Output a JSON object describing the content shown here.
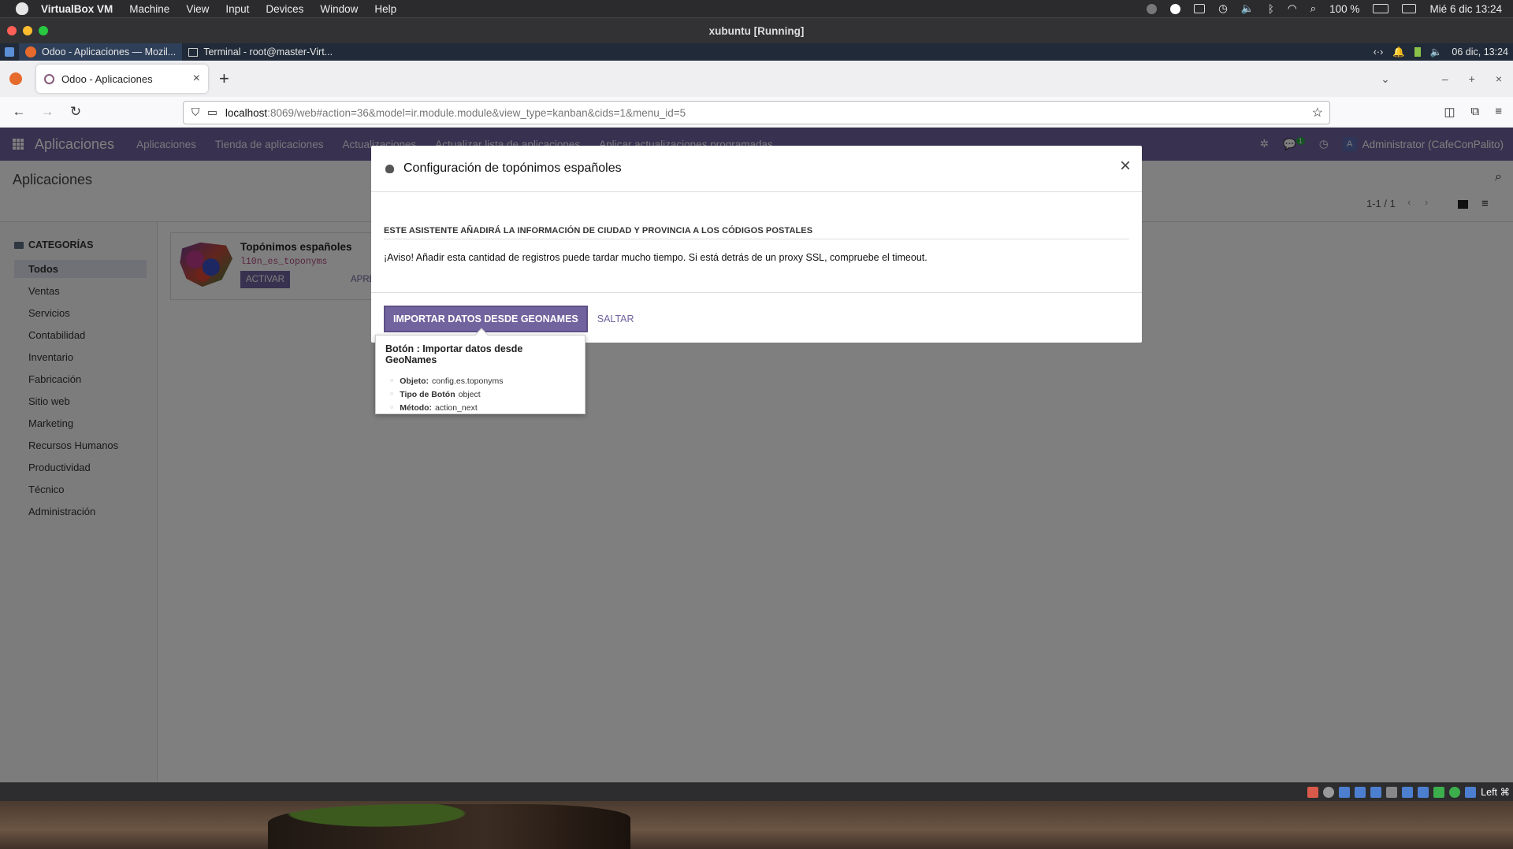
{
  "macos": {
    "app_name": "VirtualBox VM",
    "menus": [
      "Machine",
      "View",
      "Input",
      "Devices",
      "Window",
      "Help"
    ],
    "battery": "100 %",
    "datetime": "Mié 6 dic  13:24"
  },
  "vbox": {
    "window_title": "xubuntu [Running]"
  },
  "xfce": {
    "tasks": [
      {
        "label": "Odoo - Aplicaciones — Mozil..."
      },
      {
        "label": "Terminal - root@master-Virt..."
      }
    ],
    "clock": "06 dic, 13:24"
  },
  "firefox": {
    "tab_title": "Odoo - Aplicaciones",
    "url_host": "localhost",
    "url_rest": ":8069/web#action=36&model=ir.module.module&view_type=kanban&cids=1&menu_id=5"
  },
  "odoo": {
    "brand": "Aplicaciones",
    "menu": [
      "Aplicaciones",
      "Tienda de aplicaciones",
      "Actualizaciones",
      "Actualizar lista de aplicaciones",
      "Aplicar actualizaciones programadas"
    ],
    "chat_badge": "1",
    "avatar_letter": "A",
    "user": "Administrator (CafeConPalito)",
    "breadcrumb": "Aplicaciones",
    "pager": "1-1 / 1",
    "sidebar": {
      "header": "CATEGORÍAS",
      "items": [
        "Todos",
        "Ventas",
        "Servicios",
        "Contabilidad",
        "Inventario",
        "Fabricación",
        "Sitio web",
        "Marketing",
        "Recursos Humanos",
        "Productividad",
        "Técnico",
        "Administración"
      ]
    },
    "card": {
      "title": "Topónimos españoles",
      "technical": "l10n_es_toponyms",
      "activate": "ACTIVAR",
      "learn_more": "APRE"
    }
  },
  "modal": {
    "title": "Configuración de topónimos españoles",
    "separator": "Este asistente añadirá la información de ciudad y provincia a los códigos postales",
    "warning": "¡Aviso! Añadir esta cantidad de registros puede tardar mucho tiempo. Si está detrás de un proxy SSL, compruebe el timeout.",
    "primary_button": "Importar datos desde GeoNames",
    "skip_button": "Saltar"
  },
  "tooltip": {
    "title": "Botón : Importar datos desde GeoNames",
    "object_label": "Objeto:",
    "object_value": "config.es.toponyms",
    "type_label": "Tipo de Botón",
    "type_value": "object",
    "method_label": "Método:",
    "method_value": "action_next"
  },
  "statusbar": {
    "host_key": "Left ⌘"
  }
}
